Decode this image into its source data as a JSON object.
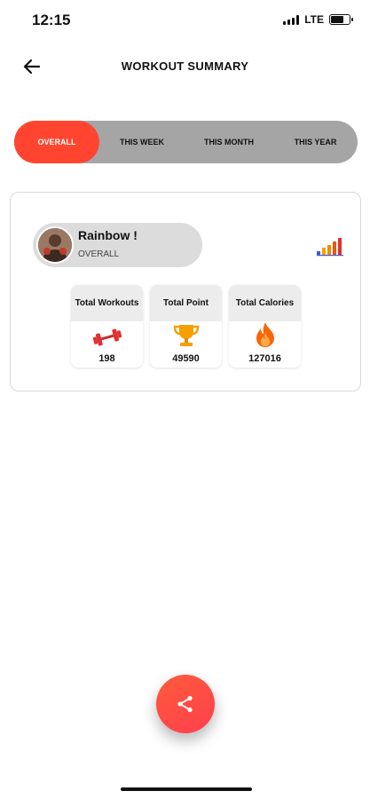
{
  "status_bar": {
    "time": "12:15",
    "network": "LTE"
  },
  "header": {
    "title": "WORKOUT SUMMARY",
    "back_icon": "arrow-left-icon"
  },
  "tabs": [
    {
      "label": "OVERALL",
      "active": true
    },
    {
      "label": "THIS WEEK",
      "active": false
    },
    {
      "label": "THIS MONTH",
      "active": false
    },
    {
      "label": "THIS YEAR",
      "active": false
    }
  ],
  "profile": {
    "name": "Rainbow !",
    "period": "OVERALL"
  },
  "stats": [
    {
      "label": "Total Workouts",
      "value": "198",
      "icon": "dumbbell-icon"
    },
    {
      "label": "Total Point",
      "value": "49590",
      "icon": "trophy-icon"
    },
    {
      "label": "Total Calories",
      "value": "127016",
      "icon": "flame-icon"
    }
  ],
  "share": {
    "icon": "share-icon"
  },
  "colors": {
    "accent": "#ff4530",
    "tab_bg": "#a5a5a5",
    "pill_bg": "#dcdcdc"
  }
}
